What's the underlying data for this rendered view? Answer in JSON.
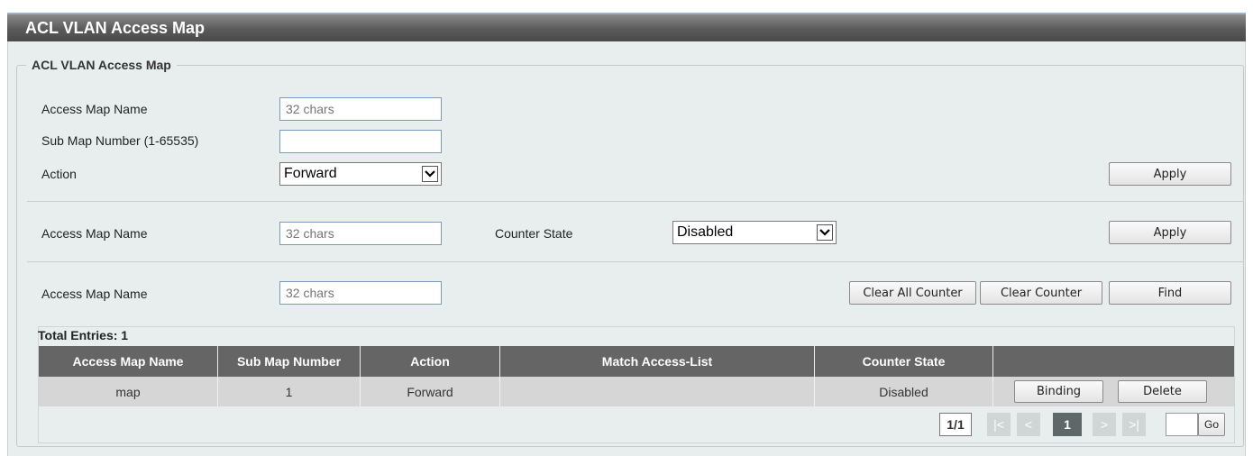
{
  "page": {
    "title": "ACL VLAN Access Map"
  },
  "group_legend": "ACL VLAN Access Map",
  "section1": {
    "access_map_label": "Access Map Name",
    "access_map_placeholder": "32 chars",
    "sub_map_label": "Sub Map Number (1-65535)",
    "sub_map_value": "",
    "action_label": "Action",
    "action_value": "Forward",
    "apply_label": "Apply"
  },
  "section2": {
    "access_map_label": "Access Map Name",
    "access_map_placeholder": "32 chars",
    "counter_state_label": "Counter State",
    "counter_state_value": "Disabled",
    "apply_label": "Apply"
  },
  "section3": {
    "access_map_label": "Access Map Name",
    "access_map_placeholder": "32 chars",
    "clear_all_label": "Clear All Counter",
    "clear_label": "Clear Counter",
    "find_label": "Find"
  },
  "table": {
    "total_entries": "Total Entries: 1",
    "headers": [
      "Access Map Name",
      "Sub Map Number",
      "Action",
      "Match Access-List",
      "Counter State",
      ""
    ],
    "rows": [
      {
        "access_map_name": "map",
        "sub_map_number": "1",
        "action": "Forward",
        "match_access_list": "",
        "counter_state": "Disabled",
        "binding_label": "Binding",
        "delete_label": "Delete"
      }
    ]
  },
  "pagination": {
    "page_info": "1/1",
    "first": "|<",
    "prev": "<",
    "current": "1",
    "next": ">",
    "last": ">|",
    "go_value": "",
    "go_label": "Go"
  },
  "colors": {
    "title_bar": "#5a5a5a",
    "background": "#e8eeee",
    "table_header": "#656565",
    "table_row": "#d6d6d6",
    "input_border": "#7d9bbf",
    "current_page": "#5f6868",
    "disabled_page": "#d0d6d6"
  }
}
